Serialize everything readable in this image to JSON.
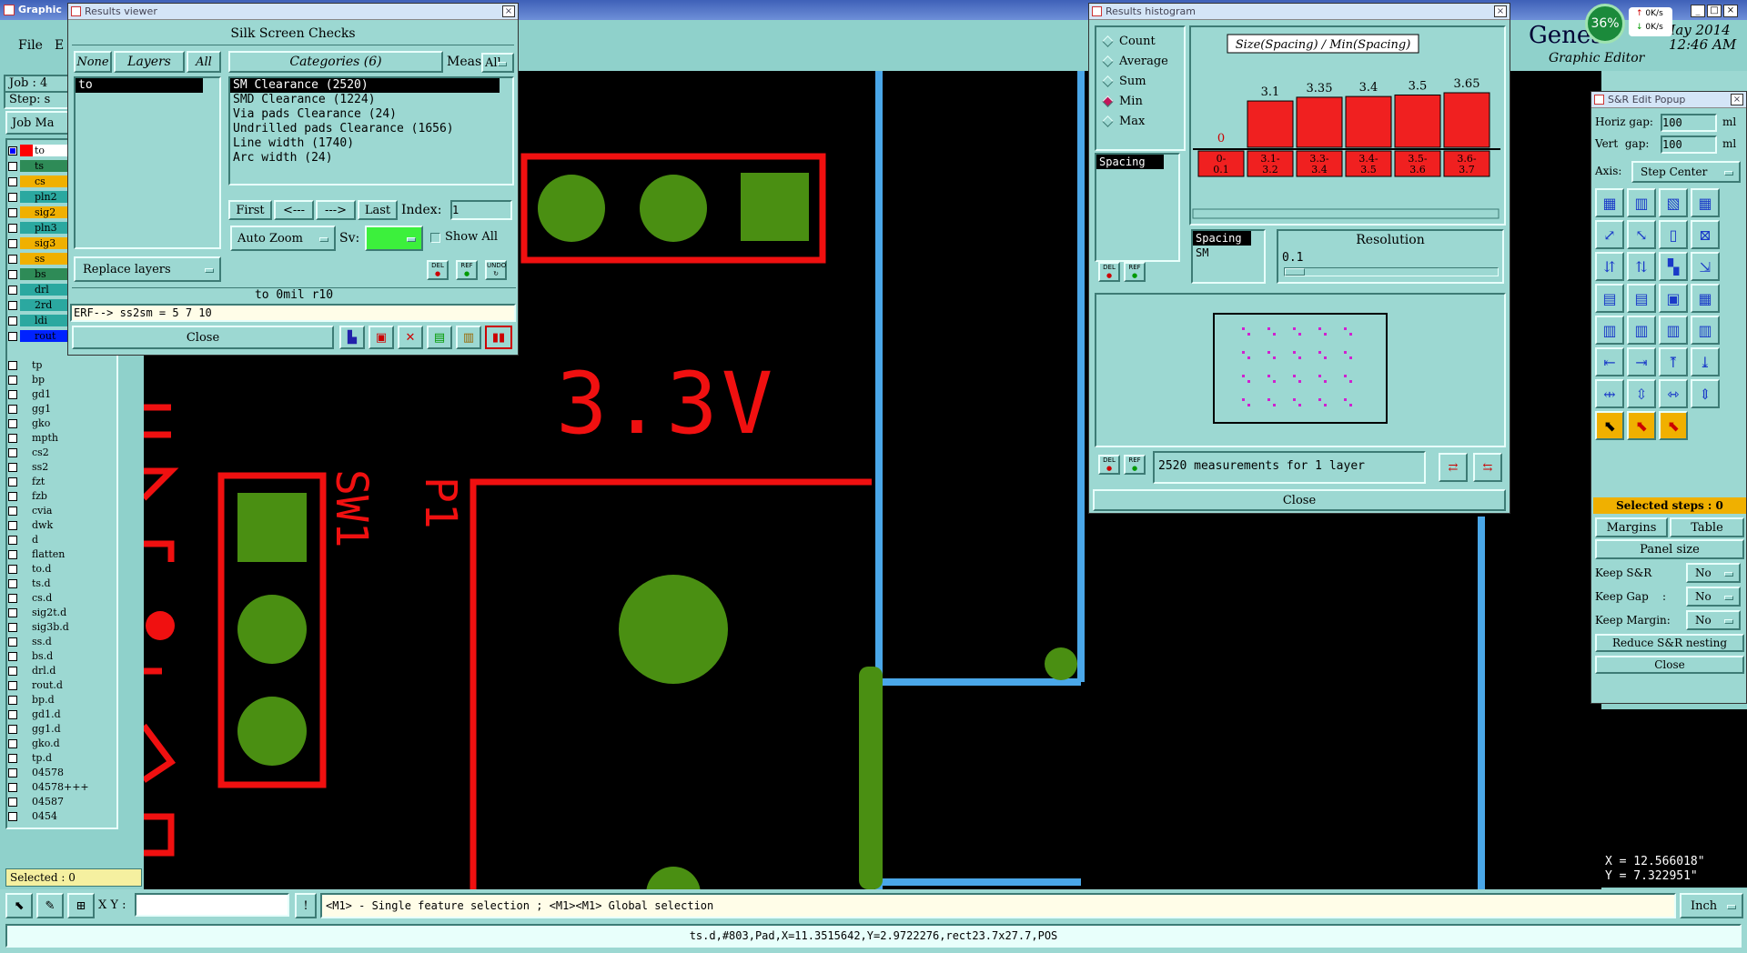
{
  "main": {
    "title": "Graphic",
    "menu": [
      "File",
      "E"
    ],
    "job_label": "Job : 4",
    "step_label": "Step: s",
    "job_matrix": "Job Ma",
    "header_right": {
      "app": "Genes",
      "date": "May 2014",
      "time": "12:46 AM",
      "subtitle": "Graphic Editor"
    },
    "layers_top": [
      {
        "name": "to",
        "color": "#f00",
        "sel": true
      },
      {
        "name": "ts",
        "color": "#2e8b57"
      },
      {
        "name": "cs",
        "color": "#f0b000"
      },
      {
        "name": "pln2",
        "color": "#2ba8a0"
      },
      {
        "name": "sig2",
        "color": "#f0b000"
      },
      {
        "name": "pln3",
        "color": "#2ba8a0"
      },
      {
        "name": "sig3",
        "color": "#f0b000"
      },
      {
        "name": "ss",
        "color": "#f0b000"
      },
      {
        "name": "bs",
        "color": "#2e8b57"
      },
      {
        "name": "drl",
        "color": "#2ba8a0"
      },
      {
        "name": "2rd",
        "color": "#2ba8a0"
      },
      {
        "name": "ldi",
        "color": "#2ba8a0"
      },
      {
        "name": "rout",
        "color": "#0022ff"
      }
    ],
    "layers": [
      "tp",
      "bp",
      "gd1",
      "gg1",
      "gko",
      "mpth",
      "cs2",
      "ss2",
      "fzt",
      "fzb",
      "cvia",
      "dwk",
      "d",
      "flatten",
      "to.d",
      "ts.d",
      "cs.d",
      "sig2t.d",
      "sig3b.d",
      "ss.d",
      "bs.d",
      "drl.d",
      "rout.d",
      "bp.d",
      "gd1.d",
      "gg1.d",
      "gko.d",
      "tp.d",
      "04578",
      "04578+++",
      "04587",
      "0454"
    ],
    "selected_label": "Selected : 0",
    "xy_label": "X Y :",
    "xy_value": "",
    "hint": "<M1> - Single feature selection ; <M1><M1> Global selection",
    "unit": "Inch",
    "status": "ts.d,#803,Pad,X=11.3515642,Y=2.9722276,rect23.7x27.7,POS",
    "coords": {
      "x": "X = 12.566018\"",
      "y": "Y = 7.322951\""
    },
    "net_badge": {
      "percent": "36%",
      "up": "0K/s",
      "down": "0K/s"
    },
    "canvas_text": {
      "voltage": "3.3V",
      "sw": "SW1",
      "p1": "P1"
    }
  },
  "results_viewer": {
    "title": "Results viewer",
    "header": "Silk Screen Checks",
    "none": "None",
    "layers": "Layers",
    "all": "All",
    "layer_items": [
      "to"
    ],
    "categories_label": "Categories (6)",
    "meas_label": "Meas:",
    "meas_value": "All",
    "categories": [
      "SM Clearance (2520)",
      "SMD Clearance (1224)",
      "Via pads Clearance (24)",
      "Undrilled pads Clearance (1656)",
      "Line width (1740)",
      "Arc width (24)"
    ],
    "nav": [
      "First",
      "<---",
      "--->",
      "Last"
    ],
    "index_label": "Index:",
    "index_value": "1",
    "auto_zoom": "Auto Zoom",
    "sv_label": "Sv:",
    "show_all": "Show All",
    "replace_layers": "Replace layers",
    "btn_del": "DEL",
    "btn_ref": "REF",
    "btn_undo": "UNDO",
    "info": "to   0mil   r10",
    "erf": "ERF--> ss2sm = 5 7 10",
    "close": "Close"
  },
  "histogram": {
    "title": "Results histogram",
    "modes": [
      {
        "label": "Count",
        "on": false
      },
      {
        "label": "Average",
        "on": false
      },
      {
        "label": "Sum",
        "on": false
      },
      {
        "label": "Min",
        "on": true
      },
      {
        "label": "Max",
        "on": false
      }
    ],
    "list_item": "Spacing",
    "chart_title": "Size(Spacing) / Min(Spacing)",
    "bars": [
      {
        "label": "0",
        "value": 0,
        "range": "0-\n0.1"
      },
      {
        "label": "3.1",
        "value": 3.1,
        "range": "3.1-\n3.2"
      },
      {
        "label": "3.35",
        "value": 3.35,
        "range": "3.3-\n3.4"
      },
      {
        "label": "3.4",
        "value": 3.4,
        "range": "3.4-\n3.5"
      },
      {
        "label": "3.5",
        "value": 3.5,
        "range": "3.5-\n3.6"
      },
      {
        "label": "3.65",
        "value": 3.65,
        "range": "3.6-\n3.7"
      }
    ],
    "spacing_list": [
      "Spacing",
      "SM"
    ],
    "resolution_label": "Resolution",
    "resolution_value": "0.1",
    "measurements": "2520 measurements for 1 layer",
    "close": "Close",
    "btn_del": "DEL",
    "btn_ref": "REF"
  },
  "sr_popup": {
    "title": "S&R Edit Popup",
    "horiz_label": "Horiz gap:",
    "horiz_value": "100",
    "horiz_unit": "ml",
    "vert_label": "Vert  gap:",
    "vert_value": "100",
    "vert_unit": "ml",
    "axis_label": "Axis:",
    "axis_value": "Step Center",
    "selected_steps": "Selected steps : 0",
    "margins": "Margins",
    "table": "Table",
    "panel_size": "Panel size",
    "keep_sr": "Keep S&R",
    "keep_gap": "Keep Gap    :",
    "keep_margin": "Keep Margin:",
    "no": "No",
    "reduce": "Reduce S&R nesting",
    "close": "Close"
  }
}
